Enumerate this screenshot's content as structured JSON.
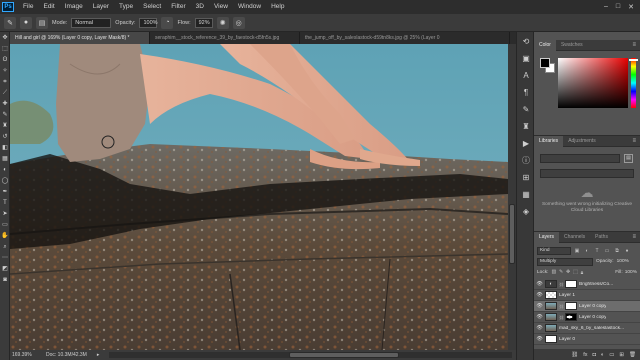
{
  "menu": {
    "items": [
      "File",
      "Edit",
      "Image",
      "Layer",
      "Type",
      "Select",
      "Filter",
      "3D",
      "View",
      "Window",
      "Help"
    ],
    "logo": "Ps"
  },
  "options": {
    "mode_label": "Mode:",
    "mode_value": "Normal",
    "opacity_label": "Opacity:",
    "opacity_value": "100%",
    "flow_label": "Flow:",
    "flow_value": "92%"
  },
  "tabs": [
    "Hill and girl @ 169% (Layer 0 copy, Layer Mask/8) *",
    "seraphim__stock_reference_39_by_faestock-d5fn5s.jpg",
    "the_jump_off_by_saleslastock-d59tn8ks.jpg @ 25% (Layer 0"
  ],
  "status": {
    "zoom": "169.39%",
    "doc": "Doc: 10.3M/42.3M"
  },
  "color_panel": {
    "tabs": [
      "Color",
      "Swatches"
    ],
    "fg": "#000000",
    "bg": "#ffffff"
  },
  "libraries_panel": {
    "tabs": [
      "Libraries",
      "Adjustments"
    ],
    "message": "Something went wrong initializing Creative Cloud Libraries"
  },
  "layers_panel": {
    "tabs": [
      "Layers",
      "Channels",
      "Paths"
    ],
    "filter": "Kind",
    "blend": "Multiply",
    "opacity_label": "Opacity:",
    "opacity_value": "100%",
    "lock_label": "Lock:",
    "fill_label": "Fill:",
    "fill_value": "100%",
    "layers": [
      {
        "name": "Brightness/Co...",
        "thumb": "adjust",
        "mask": "white"
      },
      {
        "name": "Layer 1",
        "thumb": "checker",
        "mask": ""
      },
      {
        "name": "Layer 0 copy",
        "thumb": "photo",
        "mask": "white"
      },
      {
        "name": "Layer 0 copy",
        "thumb": "photo",
        "mask": "mask-shape"
      },
      {
        "name": "mad_sky_6_by_saleslastock...",
        "thumb": "photo",
        "mask": ""
      },
      {
        "name": "Layer 0",
        "thumb": "white",
        "mask": ""
      }
    ],
    "active_index": 2
  }
}
